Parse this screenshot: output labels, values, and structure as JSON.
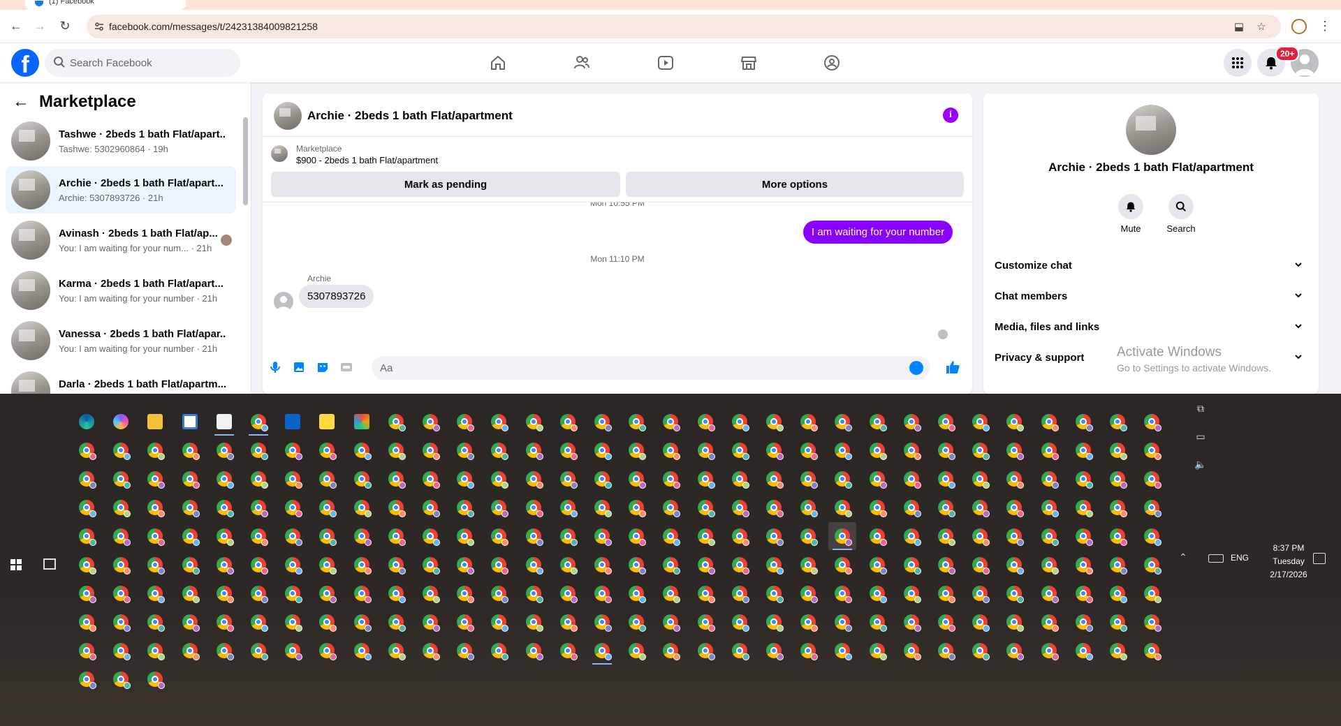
{
  "browser": {
    "tab_title": "(1) Facebook",
    "url": "facebook.com/messages/t/24231384009821258"
  },
  "fb_header": {
    "logo_letter": "f",
    "search_placeholder": "Search Facebook",
    "notification_badge": "20+"
  },
  "sidebar": {
    "title": "Marketplace",
    "conversations": [
      {
        "name": "Tashwe · 2beds 1 bath Flat/apart...",
        "subtitle": "Tashwe: 5302960864 · 19h"
      },
      {
        "name": "Archie · 2beds 1 bath Flat/apart...",
        "subtitle": "Archie: 5307893726 · 21h"
      },
      {
        "name": "Avinash · 2beds 1 bath Flat/ap...",
        "subtitle": "You: I am waiting for your num... · 21h"
      },
      {
        "name": "Karma · 2beds 1 bath Flat/apart...",
        "subtitle": "You: I am waiting for your number · 21h"
      },
      {
        "name": "Vanessa · 2beds 1 bath Flat/apar...",
        "subtitle": "You: I am waiting for your number · 21h"
      },
      {
        "name": "Darla · 2beds 1 bath Flat/apartm...",
        "subtitle": ""
      }
    ]
  },
  "chat": {
    "title": "Archie · 2beds 1 bath Flat/apartment",
    "marketplace_label": "Marketplace",
    "listing": "$900 - 2beds 1 bath Flat/apartment",
    "mark_pending_label": "Mark as pending",
    "more_options_label": "More options",
    "timestamp_top": "Mon 10:55 PM",
    "outgoing_message": "I am waiting for your number",
    "timestamp_mid": "Mon 11:10 PM",
    "incoming_sender": "Archie",
    "incoming_message": "5307893726",
    "input_placeholder": "Aa",
    "accent_color": "#8a00ff"
  },
  "details": {
    "name": "Archie · 2beds 1 bath Flat/apartment",
    "mute_label": "Mute",
    "search_label": "Search",
    "rows": [
      "Customize chat",
      "Chat members",
      "Media, files and links",
      "Privacy & support"
    ]
  },
  "watermark": {
    "line1": "Activate Windows",
    "line2": "Go to Settings to activate Windows."
  },
  "taskbar": {
    "language": "ENG",
    "time": "8:37 PM",
    "day": "Tuesday",
    "date": "2/17/2026"
  }
}
